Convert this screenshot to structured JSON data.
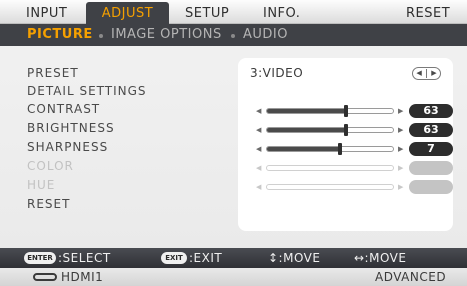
{
  "tabs": [
    "INPUT",
    "ADJUST",
    "SETUP",
    "INFO.",
    "RESET"
  ],
  "active_tab": "ADJUST",
  "subtabs": [
    "PICTURE",
    "IMAGE OPTIONS",
    "AUDIO"
  ],
  "active_subtab": "PICTURE",
  "menu": {
    "preset_label": "PRESET",
    "preset_value": "3:VIDEO",
    "detail_settings_label": "DETAIL SETTINGS",
    "contrast_label": "CONTRAST",
    "contrast_value": "63",
    "brightness_label": "BRIGHTNESS",
    "brightness_value": "63",
    "sharpness_label": "SHARPNESS",
    "sharpness_value": "7",
    "color_label": "COLOR",
    "hue_label": "HUE",
    "reset_label": "RESET"
  },
  "sliders": {
    "contrast_fraction": 0.63,
    "brightness_fraction": 0.63,
    "sharpness_fraction": 0.58
  },
  "help": {
    "enter_key": "ENTER",
    "select_label": ":SELECT",
    "exit_key": "EXIT",
    "exit_label": ":EXIT",
    "move_vertical": "↕:MOVE",
    "move_horizontal": "↔:MOVE"
  },
  "status": {
    "input_name": "HDMI1",
    "mode": "ADVANCED"
  },
  "icons": [
    "arrow-left-icon",
    "arrow-right-icon",
    "hdmi-input-icon"
  ],
  "colors": {
    "accent": "#f5a000",
    "bar_dark": "#3f4146",
    "panel": "#ffffff"
  }
}
